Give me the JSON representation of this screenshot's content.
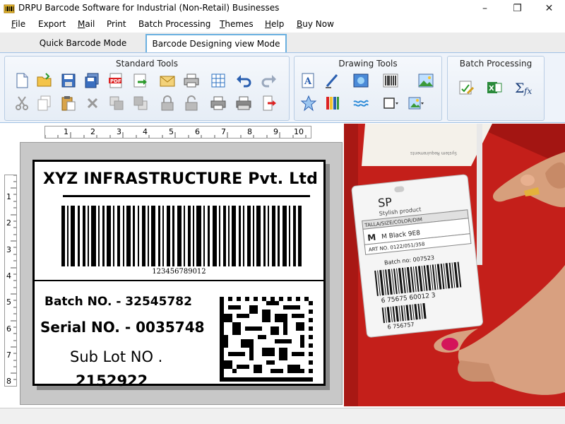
{
  "window": {
    "title": "DRPU Barcode Software for Industrial (Non-Retail) Businesses",
    "minimize_glyph": "–",
    "maximize_glyph": "❐",
    "close_glyph": "✕"
  },
  "menu": [
    {
      "label": "File",
      "accel": "F"
    },
    {
      "label": "Export",
      "accel": ""
    },
    {
      "label": "Mail",
      "accel": "M"
    },
    {
      "label": "Print",
      "accel": ""
    },
    {
      "label": "Batch Processing",
      "accel": ""
    },
    {
      "label": "Themes",
      "accel": "T"
    },
    {
      "label": "Help",
      "accel": "H"
    },
    {
      "label": "Buy Now",
      "accel": "B"
    }
  ],
  "tabs": [
    {
      "label": "Quick Barcode Mode",
      "active": false
    },
    {
      "label": "Barcode Designing view Mode",
      "active": true
    }
  ],
  "ribbon": {
    "standard_tools_title": "Standard Tools",
    "drawing_tools_title": "Drawing Tools",
    "batch_processing_title": "Batch Processing"
  },
  "ruler": {
    "h_numbers": [
      "1",
      "2",
      "3",
      "4",
      "5",
      "6",
      "7",
      "8",
      "9",
      "10"
    ],
    "v_numbers": [
      "1",
      "2",
      "3",
      "4",
      "5",
      "6",
      "7",
      "8"
    ]
  },
  "label": {
    "title": "XYZ INFRASTRUCTURE Pvt. Ltd",
    "barcode_number": "123456789012",
    "batch": "Batch NO. - 32545782",
    "serial": "Serial NO. - 0035748",
    "sub_lot_label": "Sub Lot NO .",
    "sub_lot_number": "2152922"
  },
  "photo": {
    "tag_brand": "SP",
    "tag_sub": "Stylish product",
    "tag_header": "TALLA/SIZE/COLOR/DIM",
    "tag_size": "M",
    "tag_size2": "M  Black  9E8",
    "tag_art": "ART NO. 0122/051/358",
    "tag_batch": "Batch no: 007523",
    "tag_bc_digits": "6  75675  60012  3",
    "tag_bc2_digits": "6  756757",
    "box_text": "System Requirements"
  },
  "colors": {
    "accent": "#6ab0e0",
    "ribbon_bg": "#eef3fa",
    "photo_red": "#c41f1a"
  }
}
